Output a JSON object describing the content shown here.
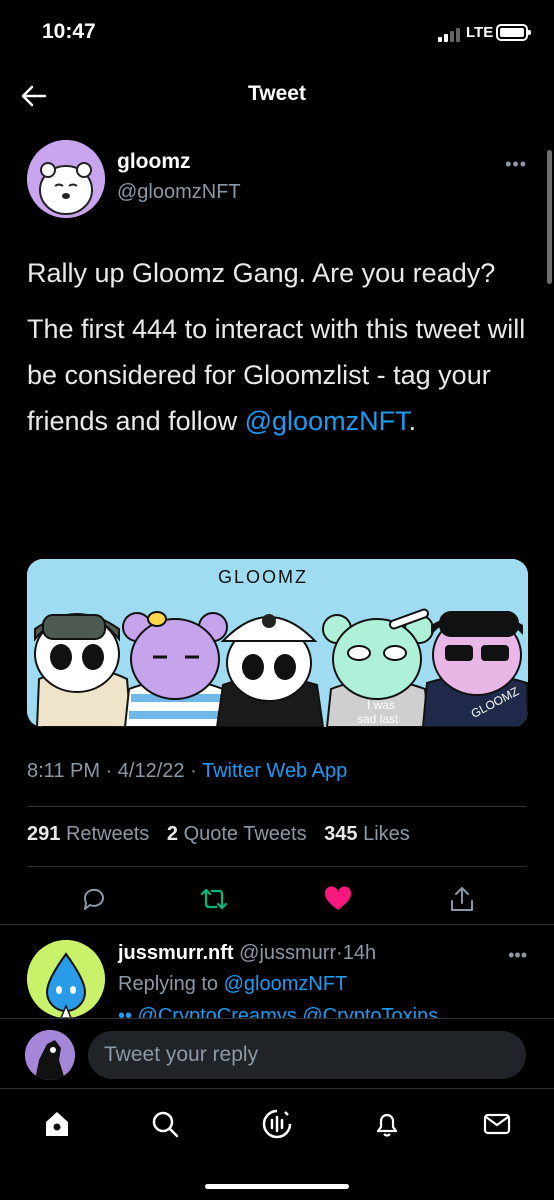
{
  "status_bar": {
    "time": "10:47",
    "network": "LTE"
  },
  "nav": {
    "title": "Tweet",
    "back_icon": "arrow-left-icon"
  },
  "tweet": {
    "author_name": "gloomz",
    "author_handle": "@gloomzNFT",
    "text_line1": "Rally up Gloomz Gang. Are you ready?",
    "text_line2_prefix": "The first 444 to interact with this tweet will be considered for Gloomzlist - tag your friends and follow ",
    "text_line2_mention": "@gloomzNFT",
    "text_line2_suffix": ".",
    "media_title": "GLOOMZ",
    "media_caption_1": "I was",
    "media_caption_2": "sad last",
    "media_caption_3": "GLOOMZ",
    "time": "8:11 PM",
    "date": "4/12/22",
    "app": "Twitter Web App",
    "separator": "·",
    "retweets_count": "291",
    "retweets_label": "Retweets",
    "quotes_count": "2",
    "quotes_label": "Quote Tweets",
    "likes_count": "345",
    "likes_label": "Likes"
  },
  "reply": {
    "name": "jussmurr.nft",
    "handle": "@jussmurr",
    "time": "14h",
    "replying_prefix": "Replying to ",
    "replying_to": "@gloomzNFT",
    "body_preview": "•• @CryptoCreamys @CryptoToxins"
  },
  "compose": {
    "placeholder": "Tweet your reply"
  },
  "colors": {
    "accent": "#1d9bf0",
    "retweet": "#00ba7c",
    "like": "#f91880",
    "background": "#000000"
  }
}
